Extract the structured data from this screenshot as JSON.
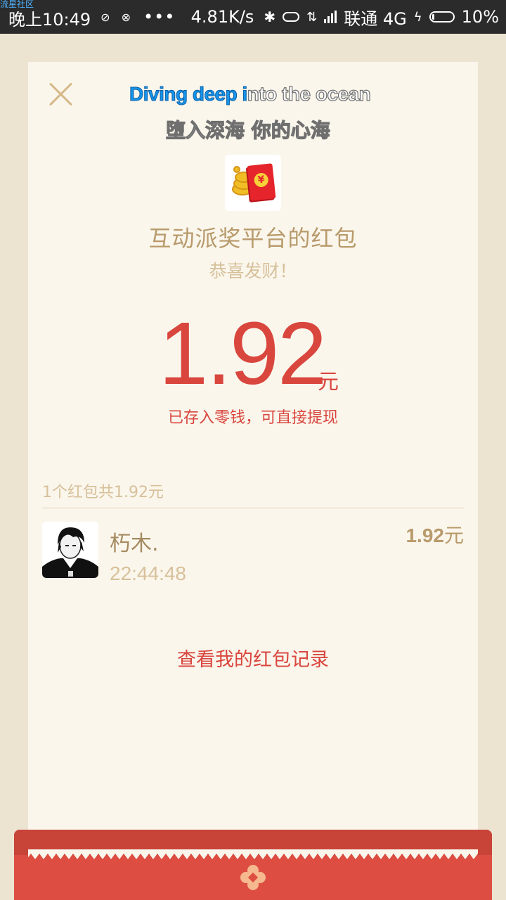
{
  "status_bar": {
    "watermark": "流星社区",
    "time": "晚上10:49",
    "dots": "•••",
    "net_speed": "4.81K/s",
    "carrier": "联通 4G",
    "battery_percent": "10%",
    "icons": [
      "sync-icon",
      "sync-icon",
      "bluetooth-icon",
      "link-icon",
      "data-arrows-icon",
      "signal-icon",
      "charging-icon",
      "battery-icon"
    ]
  },
  "overlay": {
    "line1_highlight": "Diving deep i",
    "line1_rest": "nto the ocean",
    "line2": "堕入深海 你的心海"
  },
  "envelope": {
    "sender": "互动派奖平台的红包",
    "blessing": "恭喜发财！",
    "amount": "1.92",
    "unit": "元",
    "note": "已存入零钱，可直接提现"
  },
  "summary": "1个红包共1.92元",
  "receivers": [
    {
      "name": "朽木.",
      "time": "22:44:48",
      "amount": "1.92",
      "unit": "元"
    }
  ],
  "history_link": "查看我的红包记录",
  "colors": {
    "accent_red": "#d9463e",
    "gold": "#b89a6b",
    "light_gold": "#d7c09a",
    "card_bg": "#faf6ec",
    "page_bg": "#ece3d1"
  }
}
